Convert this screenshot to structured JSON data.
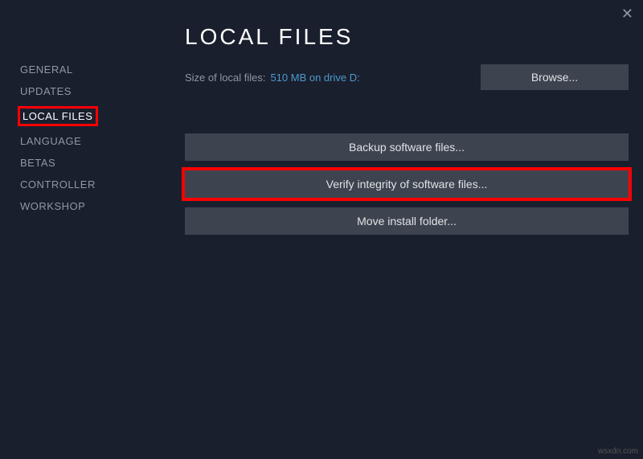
{
  "close_label": "✕",
  "sidebar": {
    "items": [
      {
        "label": "GENERAL"
      },
      {
        "label": "UPDATES"
      },
      {
        "label": "LOCAL FILES"
      },
      {
        "label": "LANGUAGE"
      },
      {
        "label": "BETAS"
      },
      {
        "label": "CONTROLLER"
      },
      {
        "label": "WORKSHOP"
      }
    ]
  },
  "main": {
    "title": "LOCAL FILES",
    "size_label": "Size of local files:",
    "size_value": "510 MB on drive D:",
    "browse_label": "Browse...",
    "buttons": {
      "backup": "Backup software files...",
      "verify": "Verify integrity of software files...",
      "move": "Move install folder..."
    }
  },
  "watermark": "wsxdn.com"
}
